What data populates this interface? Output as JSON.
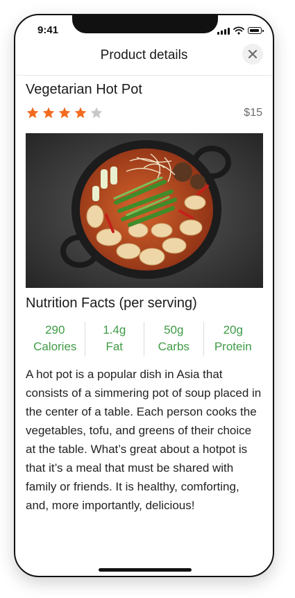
{
  "status_bar": {
    "time": "9:41"
  },
  "header": {
    "title": "Product details",
    "close_icon": "close-icon"
  },
  "product": {
    "name": "Vegetarian Hot Pot",
    "rating": 4,
    "rating_max": 5,
    "price": "$15"
  },
  "nutrition": {
    "title": "Nutrition Facts (per serving)",
    "items": [
      {
        "value": "290",
        "label": "Calories"
      },
      {
        "value": "1.4g",
        "label": "Fat"
      },
      {
        "value": "50g",
        "label": "Carbs"
      },
      {
        "value": "20g",
        "label": "Protein"
      }
    ]
  },
  "description": "A hot pot is a popular dish in Asia that consists of a simmering pot of soup placed in the center of a table. Each person cooks the vegetables, tofu, and greens of their choice at the table. What’s great about a hotpot is that it’s a meal that must be shared with family or friends. It is healthy, comforting, and, more importantly, delicious!",
  "colors": {
    "star_filled": "#f26b22",
    "star_empty": "#c8c8c8",
    "accent_green": "#3f9b46"
  }
}
